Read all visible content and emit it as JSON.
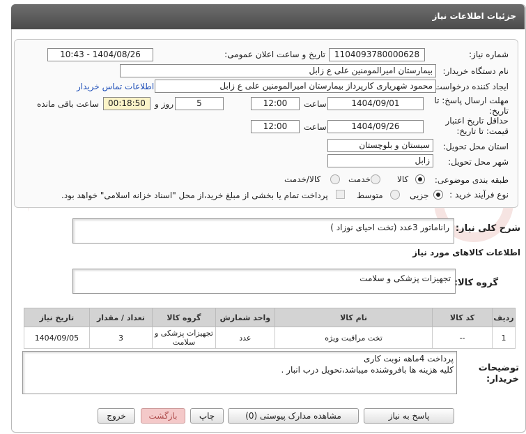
{
  "header": {
    "title": "جزئیات اطلاعات نیاز"
  },
  "fields": {
    "need_number_label": "شماره نیاز:",
    "need_number": "1104093780000628",
    "announce_label": "تاریخ و ساعت اعلان عمومی:",
    "announce_value": "1404/08/26 - 10:43",
    "buyer_org_label": "نام دستگاه خریدار:",
    "buyer_org": "بیمارستان امیرالمومنین علی  ع  زابل",
    "creator_label": "ایجاد کننده درخواست:",
    "creator": "محمود شهریاری کارپرداز بیمارستان امیرالمومنین علی  ع  زابل",
    "contact_link": "اطلاعات تماس خریدار",
    "reply_deadline_label": "مهلت ارسال پاسخ: تا تاریخ:",
    "reply_date": "1404/09/01",
    "time_label": "ساعت",
    "reply_time": "12:00",
    "days_value": "5",
    "days_label": "روز و",
    "remaining_time": "00:18:50",
    "remaining_label": "ساعت باقی مانده",
    "price_validity_label": "حداقل تاریخ اعتبار قیمت: تا تاریخ:",
    "validity_date": "1404/09/26",
    "validity_time": "12:00",
    "province_label": "استان محل تحویل:",
    "province": "سیستان و بلوچستان",
    "city_label": "شهر محل تحویل:",
    "city": "زابل",
    "category_label": "طبقه بندی موضوعی:",
    "cat_goods": "کالا",
    "cat_service": "خدمت",
    "cat_goods_service": "کالا/خدمت",
    "process_label": "نوع فرآیند خرید :",
    "proc_partial": "جزیی",
    "proc_medium": "متوسط",
    "payment_note": "پرداخت تمام یا بخشی از مبلغ خرید،از محل \"اسناد خزانه اسلامی\" خواهد بود."
  },
  "summary": {
    "label": "شرح کلی نیاز:",
    "text": "راناماتور 3عدد    (تخت احیای نوزاد )"
  },
  "goods_info": {
    "title": "اطلاعات کالاهای مورد نیاز",
    "group_label": "گروه کالا:",
    "group_value": "تجهیزات پزشکی و سلامت"
  },
  "table": {
    "headers": [
      "ردیف",
      "کد کالا",
      "نام کالا",
      "واحد شمارش",
      "گروه کالا",
      "تعداد / مقدار",
      "تاریخ نیاز"
    ],
    "rows": [
      [
        "1",
        "--",
        "تخت مراقبت ویژه",
        "عدد",
        "تجهیزات پزشکی و سلامت",
        "3",
        "1404/09/05"
      ]
    ]
  },
  "buyer_notes": {
    "label": "توضیحات خریدار:",
    "line1": "پرداخت 4ماهه نوبت کاری",
    "line2": "کلیه هزینه ها بافروشنده میباشد،تحویل درب انبار ."
  },
  "buttons": {
    "reply": "پاسخ به نیاز",
    "attachments": "مشاهده مدارک پیوستی (0)",
    "print": "چاپ",
    "back": "بازگشت",
    "exit": "خروج"
  },
  "watermark_text": "AriaTender.neT",
  "colors": {
    "header": "#5a5a5a",
    "link": "#1f4fb8",
    "remaining_bg": "#fbf4c8",
    "exit_btn": "#f4c9c9"
  }
}
